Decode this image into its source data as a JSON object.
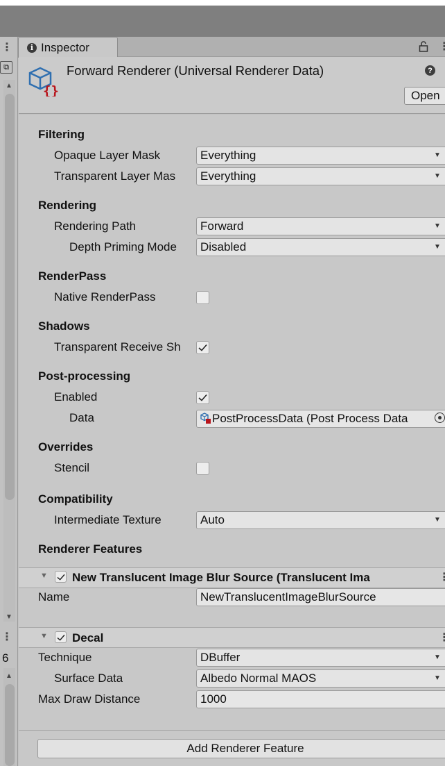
{
  "window": {
    "tab_title": "Inspector"
  },
  "header": {
    "title": "Forward Renderer (Universal Renderer Data)",
    "help": "?",
    "open_label": "Open"
  },
  "left_panel": {
    "count_text": "6"
  },
  "sections": {
    "filtering": {
      "title": "Filtering",
      "opaque_label": "Opaque Layer Mask",
      "opaque_value": "Everything",
      "transparent_label": "Transparent Layer Mas",
      "transparent_value": "Everything"
    },
    "rendering": {
      "title": "Rendering",
      "path_label": "Rendering Path",
      "path_value": "Forward",
      "depth_label": "Depth Priming Mode",
      "depth_value": "Disabled"
    },
    "renderpass": {
      "title": "RenderPass",
      "native_label": "Native RenderPass",
      "native_checked": false
    },
    "shadows": {
      "title": "Shadows",
      "receive_label": "Transparent Receive Sh",
      "receive_checked": true
    },
    "post": {
      "title": "Post-processing",
      "enabled_label": "Enabled",
      "enabled_checked": true,
      "data_label": "Data",
      "data_value": "PostProcessData (Post Process Data"
    },
    "overrides": {
      "title": "Overrides",
      "stencil_label": "Stencil",
      "stencil_checked": false
    },
    "compatibility": {
      "title": "Compatibility",
      "texture_label": "Intermediate Texture",
      "texture_value": "Auto"
    },
    "features": {
      "title": "Renderer Features"
    }
  },
  "feature_blur": {
    "title": "New Translucent Image Blur Source (Translucent Ima",
    "name_label": "Name",
    "name_value": "NewTranslucentImageBlurSource"
  },
  "feature_decal": {
    "title": "Decal",
    "technique_label": "Technique",
    "technique_value": "DBuffer",
    "surface_label": "Surface Data",
    "surface_value": "Albedo Normal MAOS",
    "distance_label": "Max Draw Distance",
    "distance_value": "1000"
  },
  "footer": {
    "add_label": "Add Renderer Feature"
  }
}
